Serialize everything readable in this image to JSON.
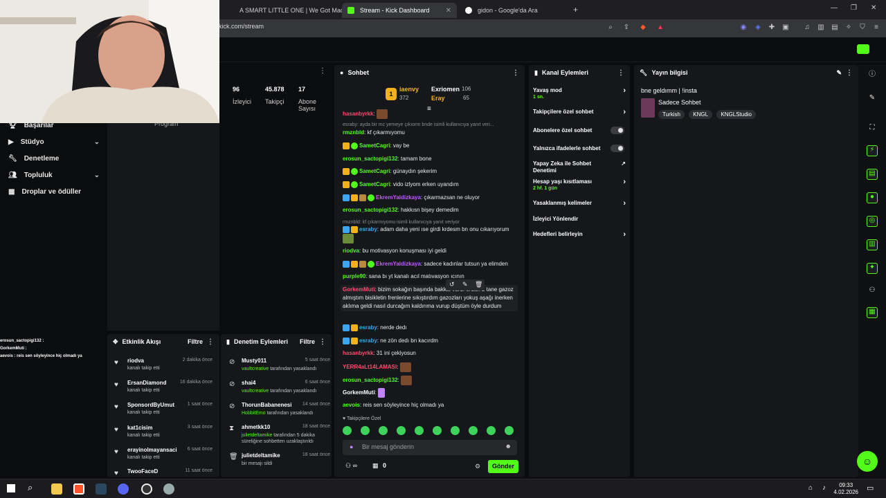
{
  "browser": {
    "tabs": [
      {
        "label": "A SMART LITTLE ONE | We Got Mad",
        "fav": "#ff0000"
      },
      {
        "label": "Stream - Kick Dashboard",
        "fav": "#53fc18"
      },
      {
        "label": "gidon - Google'da Ara",
        "fav": "#ffffff"
      }
    ],
    "url": "kick.com/stream"
  },
  "leftnav": {
    "items": [
      {
        "label": "Başarılar",
        "icon": "trophy-icon"
      },
      {
        "label": "Stüdyo",
        "icon": "video-icon"
      },
      {
        "label": "Denetleme",
        "icon": "wrench-icon"
      },
      {
        "label": "Topluluk",
        "icon": "people-icon"
      },
      {
        "label": "Droplar ve ödüller",
        "icon": "gift-icon"
      }
    ]
  },
  "stats": {
    "program_label": "Program",
    "items": [
      {
        "value": "96",
        "label": "İzleyici"
      },
      {
        "value": "45.878",
        "label": "Takipçi"
      },
      {
        "value": "17",
        "label": "Abone Sayısı"
      }
    ]
  },
  "overlay_chat": [
    "erosun_sactopigi132 :",
    "GorkemMuti :",
    "aevois : reis sen söyleyince hiç olmadı ya"
  ],
  "activity": {
    "title": "Etkinlik Akışı",
    "filter": "Filtre",
    "items": [
      {
        "name": "riodva",
        "sub": "kanalı takip etti",
        "time": "2 dakika önce"
      },
      {
        "name": "ErsanDiamond",
        "sub": "kanalı takip etti",
        "time": "16 dakika önce"
      },
      {
        "name": "SponsordByUmut",
        "sub": "kanalı takip etti",
        "time": "1 saat önce"
      },
      {
        "name": "kat1cisim",
        "sub": "kanalı takip etti",
        "time": "3 saat önce"
      },
      {
        "name": "erayinolmayansaci",
        "sub": "kanalı takip etti",
        "time": "6 saat önce"
      },
      {
        "name": "TwooFaceD",
        "sub": "",
        "time": "11 saat önce"
      }
    ]
  },
  "moderation": {
    "title": "Denetim Eylemleri",
    "filter": "Filtre",
    "items": [
      {
        "name": "Musty011",
        "time": "5 saat önce",
        "mod": "vaultcreative",
        "action": " tarafından yasaklandı"
      },
      {
        "name": "shai4",
        "time": "6 saat önce",
        "mod": "vaultcreative",
        "action": " tarafından yasaklandı"
      },
      {
        "name": "ThorunBabanenesi",
        "time": "14 saat önce",
        "mod": "HobbitEmo",
        "action": " tarafından yasaklandı"
      },
      {
        "name": "ahmetkk10",
        "time": "18 saat önce",
        "mod": "julietdeltamike",
        "action": " tarafından 5 dakika süreliğine sohbetten uzaklaştırıldı"
      },
      {
        "name": "julietdeltamike",
        "time": "18 saat önce",
        "mod": "",
        "action": "bir mesajı sildi"
      }
    ]
  },
  "chat": {
    "title": "Sohbet",
    "leaderboard": {
      "rank1_name": "iaenvy",
      "rank1_score": "372",
      "rank2_name": "Exriomen",
      "rank2_score": "106",
      "rank3_name": "Eray",
      "rank3_score": "65"
    },
    "messages": [
      {
        "user": "hasanbyrkk",
        "color": "#ff4b6e",
        "text": "",
        "emote": true
      },
      {
        "reply": "esraby: ayda bir mc yemeye çıkıorm bnde isimli kullanıcıya yanıt veri..."
      },
      {
        "user": "rmznbld",
        "color": "#53fc18",
        "text": "kf çıkarmıyomu"
      },
      {
        "user": "SametCagri",
        "color": "#53fc18",
        "text": "vay be",
        "badges": "cv"
      },
      {
        "user": "erosun_sactopigi132",
        "color": "#53fc18",
        "text": "tamam bone"
      },
      {
        "user": "SametCagri",
        "color": "#53fc18",
        "text": "günaydın şekerim",
        "badges": "cv"
      },
      {
        "user": "SametCagri",
        "color": "#53fc18",
        "text": "vido izlyom erken uyandım",
        "badges": "cv"
      },
      {
        "user": "EkremYaldizkaya",
        "color": "#c15cff",
        "text": "çıkarmazsan ne oluyor",
        "badges": "bcsv"
      },
      {
        "user": "erosun_sactopigi132",
        "color": "#53fc18",
        "text": "hakkısn bişey demedim"
      },
      {
        "reply": "rmznbld: kf çıkarmıyomu isimli kullanıcıya yanıt veriyor"
      },
      {
        "user": "esraby",
        "color": "#3aa7f0",
        "text": "adam daha yeni ıse girdi krdesm bn onu cıkarıyorum",
        "badges": "bc"
      },
      {
        "user": "riodva",
        "color": "#53fc18",
        "text": "bu motivasyon konuşması iyi geldi"
      },
      {
        "user": "EkremYaldizkaya",
        "color": "#c15cff",
        "text": "sadece kadınlar tutsun ya elimden",
        "badges": "bcsv"
      },
      {
        "user": "purple90",
        "color": "#53fc18",
        "text": "sana bı yt kanalı acıl matıvasyon ıcının"
      },
      {
        "user": "GorkemMuti",
        "color": "#ff4b6e",
        "text": "bizim sokağın başında bakkal vardı ordan 2 tane gazoz almıştım bisikletin frenlerine sıkıştırdım gazozları yokuş aşağı inerken aklıma geldi nasıl durcağım kaldırıma vurup düştüm öyle durdum"
      },
      {
        "user": "esraby",
        "color": "#3aa7f0",
        "text": "nerde dedı",
        "badges": "bc"
      },
      {
        "user": "esraby",
        "color": "#3aa7f0",
        "text": "ne zön dedı bn kacırdm",
        "badges": "bc"
      },
      {
        "user": "hasanbyrkk",
        "color": "#ff4b6e",
        "text": "31 ini çekiyosun"
      },
      {
        "user": "YERR4aLt14LAMASI",
        "color": "#ff4b6e",
        "text": "",
        "emote": true
      },
      {
        "user": "erosun_sactopigi132",
        "color": "#53fc18",
        "text": "",
        "emote": true
      },
      {
        "user": "GorkemMuti",
        "color": "#ffffff",
        "text": "",
        "emote": true
      },
      {
        "user": "aevois",
        "color": "#53fc18",
        "text": "reis sen söyleyince hiç olmadı ya"
      }
    ],
    "followers_only": "Takipçilere Özel",
    "input_placeholder": "Bir mesaj gönderin",
    "points_count": "0",
    "send_label": "Gönder"
  },
  "channel_actions": {
    "title": "Kanal Eylemleri",
    "items": [
      {
        "label": "Yavaş mod",
        "sub": "1 sn.",
        "kind": "chev"
      },
      {
        "label": "Takipçilere özel sohbet",
        "sub": "",
        "kind": "chev"
      },
      {
        "label": "Abonelere özel sohbet",
        "sub": "",
        "kind": "toggle"
      },
      {
        "label": "Yalnızca ifadelerle sohbet",
        "sub": "",
        "kind": "toggle"
      },
      {
        "label": "Yapay Zeka ile Sohbet Denetimi",
        "sub": "",
        "kind": "ext"
      },
      {
        "label": "Hesap yaşı kısıtlaması",
        "sub": "2 hf. 1 gün",
        "kind": "chev"
      },
      {
        "label": "Yasaklanmış kelimeler",
        "sub": "",
        "kind": "chev"
      },
      {
        "label": "İzleyici Yönlendir",
        "sub": "",
        "kind": "none"
      },
      {
        "label": "Hedefleri belirleyin",
        "sub": "",
        "kind": "chev"
      }
    ]
  },
  "stream_info": {
    "title": "Yayın bilgisi",
    "stream_title": "bne geldımm | !insta",
    "category": "Sadece Sohbet",
    "tags": [
      "Turkish",
      "KNGL",
      "KNGLStudio"
    ]
  },
  "taskbar": {
    "time": "09:33",
    "date": "4.02.2026"
  }
}
